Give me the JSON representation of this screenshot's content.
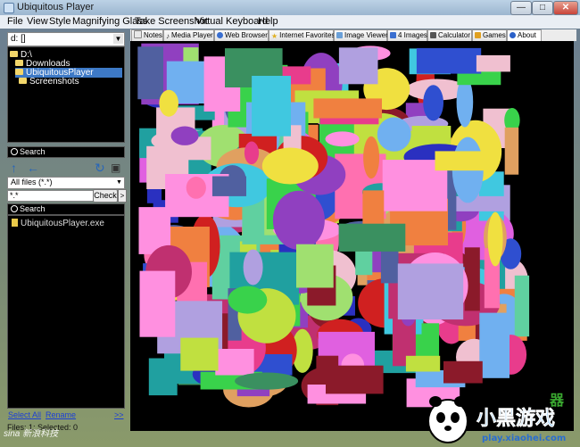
{
  "window": {
    "title": "Ubiquitous Player",
    "min": "—",
    "max": "□",
    "close": "✕"
  },
  "menu": [
    "File",
    "View",
    "Style",
    "Magnifying Glass",
    "Take Screenshot",
    "Virtual Keyboard",
    "Help"
  ],
  "left": {
    "drive": "d: []",
    "tree": [
      {
        "label": "D:\\",
        "indent": 0,
        "selected": false
      },
      {
        "label": "Downloads",
        "indent": 1,
        "selected": false
      },
      {
        "label": "UbiquitousPlayer",
        "indent": 1,
        "selected": true
      },
      {
        "label": "Screenshots",
        "indent": 1,
        "selected": false
      }
    ],
    "search1": "Search",
    "filter": "All files (*.*)",
    "pattern": "*.*",
    "check_label": "Check",
    "more_label": ">",
    "search2": "Search",
    "results": [
      "UbiquitousPlayer.exe"
    ],
    "links": {
      "select_all": "Select All",
      "rename": "Rename",
      "more": ">>"
    },
    "status": "Files: 1; Selected: 0"
  },
  "tabs": [
    {
      "label": "Notes",
      "icon": "note-icon",
      "color": "#e8e8e8",
      "active": false
    },
    {
      "label": "Media Player",
      "icon": "music-note-icon",
      "color": "#333333",
      "active": false
    },
    {
      "label": "Web Browser",
      "icon": "globe-icon",
      "color": "#3a6fd0",
      "active": false
    },
    {
      "label": "Internet Favorites",
      "icon": "star-icon",
      "color": "#e0b020",
      "active": false
    },
    {
      "label": "Image Viewer",
      "icon": "picture-icon",
      "color": "#6aa0d8",
      "active": false
    },
    {
      "label": "4 Images",
      "icon": "grid-icon",
      "color": "#3a6fd0",
      "active": false
    },
    {
      "label": "Calculator",
      "icon": "calculator-icon",
      "color": "#555555",
      "active": false
    },
    {
      "label": "Games",
      "icon": "games-icon",
      "color": "#e0a020",
      "active": false
    },
    {
      "label": "About",
      "icon": "info-icon",
      "color": "#2a60c8",
      "active": true
    }
  ],
  "watermark": {
    "sina": "sina 新浪科技",
    "site": "小黑游戏",
    "domain": "play.xiaohei.com",
    "mascot": "panda-mascot-icon"
  },
  "colors": {
    "selection": "#3d79c6",
    "link": "#1b3fd6",
    "canvas_bg": "#000000"
  }
}
